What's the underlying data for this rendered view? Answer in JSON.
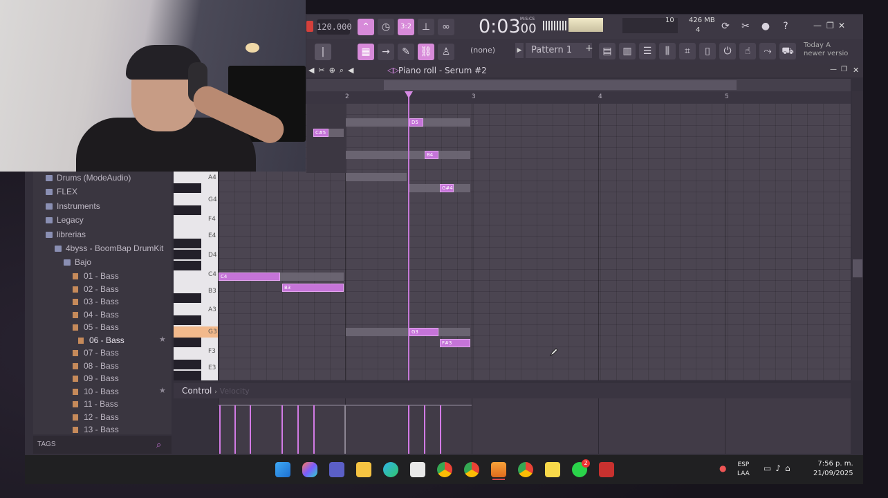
{
  "toolbar": {
    "tempo": "120.000",
    "time": "0:03",
    "time_frac": "00",
    "time_unit": "M:S:CS",
    "cpu": "10",
    "ram": "426 MB",
    "voices": "4",
    "none_label": "(none)",
    "pattern": "Pattern 1",
    "news_line1": "Today  A",
    "news_line2": "newer versio"
  },
  "piano_roll": {
    "title": "Piano roll - Serum #2",
    "timeline_marks": [
      "2",
      "3",
      "4",
      "5"
    ],
    "key_labels": [
      "A4",
      "G4",
      "F4",
      "E4",
      "D4",
      "C4",
      "B3",
      "A3",
      "G3",
      "F3",
      "E3"
    ],
    "notes": [
      "C#5",
      "D5",
      "B4",
      "G#4",
      "C4",
      "B3",
      "G3",
      "F#3"
    ],
    "control_label": "Control",
    "control_sub": "Velocity"
  },
  "browser": {
    "items": [
      "Drums (ModeAudio)",
      "FLEX",
      "Instruments",
      "Legacy",
      "librerias",
      "4byss - BoomBap DrumKit",
      "Bajo"
    ],
    "files": [
      "01 - Bass",
      "02 - Bass",
      "03 - Bass",
      "04 - Bass",
      "05 - Bass",
      "06 - Bass",
      "07 - Bass",
      "08 - Bass",
      "09 - Bass",
      "10 - Bass",
      "11 - Bass",
      "12 - Bass",
      "13 - Bass"
    ],
    "tags_label": "TAGS"
  },
  "taskbar": {
    "lang_line1": "ESP",
    "lang_line2": "LAA",
    "clock_time": "7:56 p. m.",
    "clock_date": "21/09/2025",
    "whatsapp_badge": "2"
  },
  "colors": {
    "accent": "#c574d8",
    "bg": "#34303b"
  }
}
